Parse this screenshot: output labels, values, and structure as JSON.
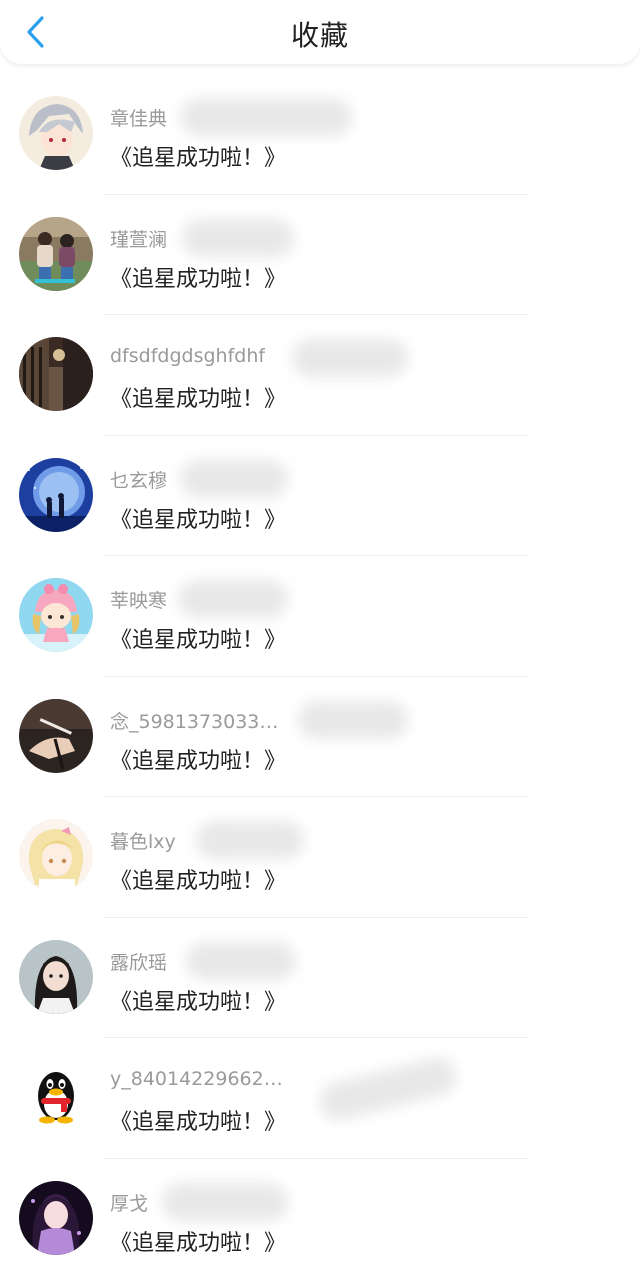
{
  "header": {
    "title": "收藏"
  },
  "colors": {
    "accent": "#2aa0f0",
    "text": "#222222",
    "secondary": "#9a9a9a"
  },
  "items": [
    {
      "name": "章佳典",
      "subtitle": "《追星成功啦！》",
      "avatar": "anime-boy-avatar"
    },
    {
      "name": "瑾萱澜",
      "subtitle": "《追星成功啦！》",
      "avatar": "kids-photo-avatar"
    },
    {
      "name": "dfsdfdgdsghfdhf",
      "subtitle": "《追星成功啦！》",
      "avatar": "night-street-avatar"
    },
    {
      "name": "乜玄穆",
      "subtitle": "《追星成功啦！》",
      "avatar": "moon-couple-avatar"
    },
    {
      "name": "莘映寒",
      "subtitle": "《追星成功啦！》",
      "avatar": "cartoon-girl-avatar"
    },
    {
      "name": "念_5981373033…",
      "subtitle": "《追星成功啦！》",
      "avatar": "hand-cigarette-avatar"
    },
    {
      "name": "暮色lxy",
      "subtitle": "《追星成功啦！》",
      "avatar": "anime-girl-avatar"
    },
    {
      "name": "露欣瑶",
      "subtitle": "《追星成功啦！》",
      "avatar": "girl-photo-avatar"
    },
    {
      "name": "y_840142296626…",
      "subtitle": "《追星成功啦！》",
      "avatar": "qq-penguin-avatar"
    },
    {
      "name": "厚戈",
      "subtitle": "《追星成功啦！》",
      "avatar": "fantasy-girl-avatar"
    }
  ]
}
